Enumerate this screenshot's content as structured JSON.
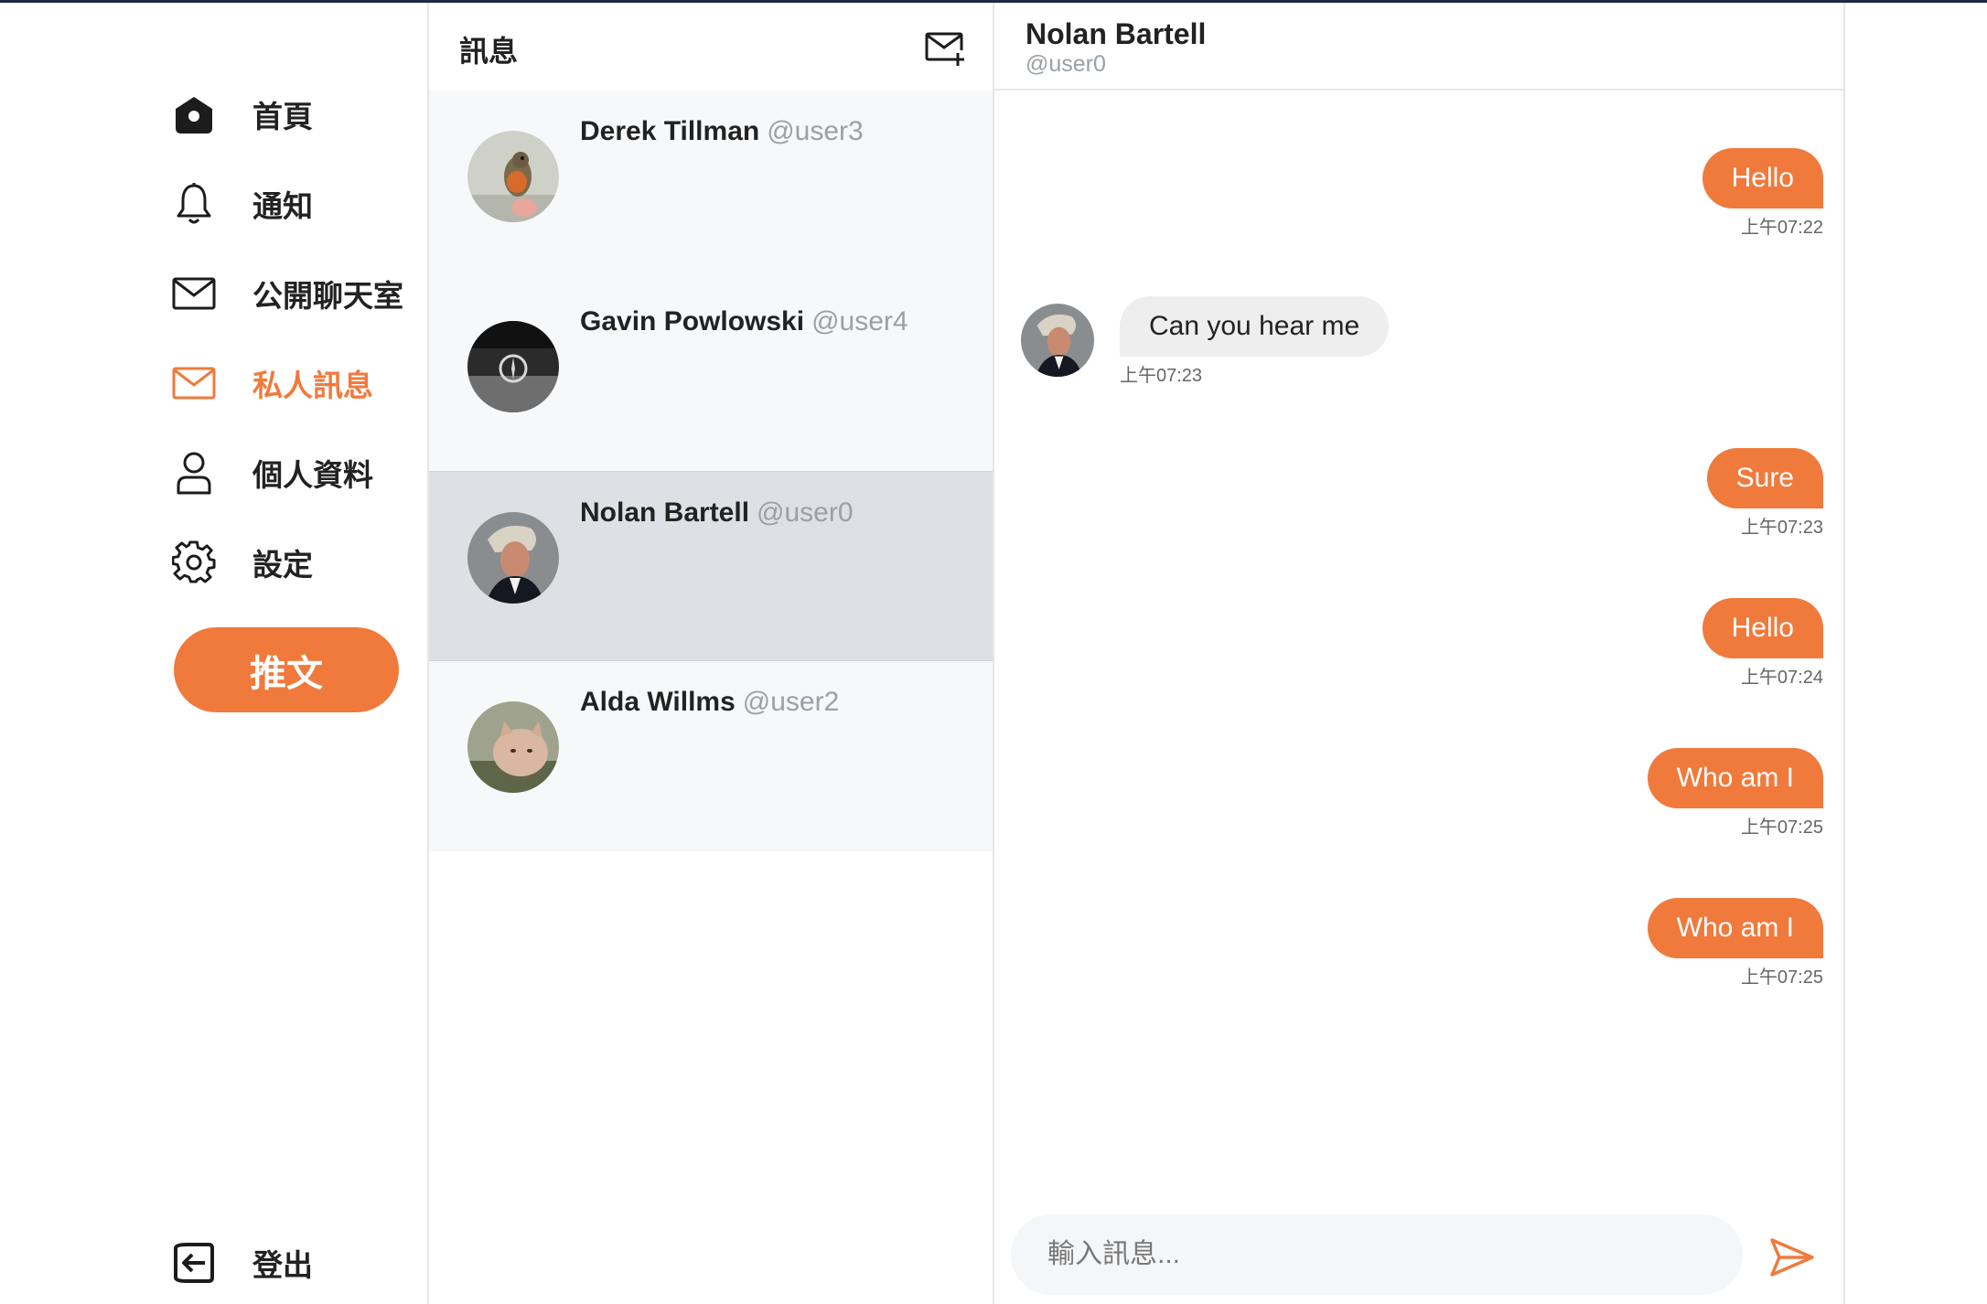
{
  "colors": {
    "accent": "#f07a3c",
    "selected_bg": "#dde0e4",
    "list_bg": "#f7f8fa"
  },
  "sidebar": {
    "items": [
      {
        "label": "首頁",
        "icon": "home-icon"
      },
      {
        "label": "通知",
        "icon": "bell-icon"
      },
      {
        "label": "公開聊天室",
        "icon": "mail-icon"
      },
      {
        "label": "私人訊息",
        "icon": "mail-icon",
        "active": true
      },
      {
        "label": "個人資料",
        "icon": "user-icon"
      },
      {
        "label": "設定",
        "icon": "gear-icon"
      }
    ],
    "tweet_label": "推文",
    "logout_label": "登出"
  },
  "messages_panel": {
    "title": "訊息",
    "conversations": [
      {
        "name": "Derek Tillman",
        "handle": "@user3",
        "avatar": "robin-bird-avatar"
      },
      {
        "name": "Gavin Powlowski",
        "handle": "@user4",
        "avatar": "car-emblem-avatar"
      },
      {
        "name": "Nolan Bartell",
        "handle": "@user0",
        "avatar": "man-portrait-avatar",
        "selected": true
      },
      {
        "name": "Alda Willms",
        "handle": "@user2",
        "avatar": "cat-avatar"
      }
    ]
  },
  "chat": {
    "name": "Nolan Bartell",
    "handle": "@user0",
    "messages": [
      {
        "from": "me",
        "text": "Hello",
        "time": "上午07:22"
      },
      {
        "from": "them",
        "text": "Can you hear me",
        "time": "上午07:23"
      },
      {
        "from": "me",
        "text": "Sure",
        "time": "上午07:23"
      },
      {
        "from": "me",
        "text": "Hello",
        "time": "上午07:24"
      },
      {
        "from": "me",
        "text": "Who am I",
        "time": "上午07:25"
      },
      {
        "from": "me",
        "text": "Who am I",
        "time": "上午07:25"
      }
    ],
    "input_placeholder": "輸入訊息..."
  }
}
